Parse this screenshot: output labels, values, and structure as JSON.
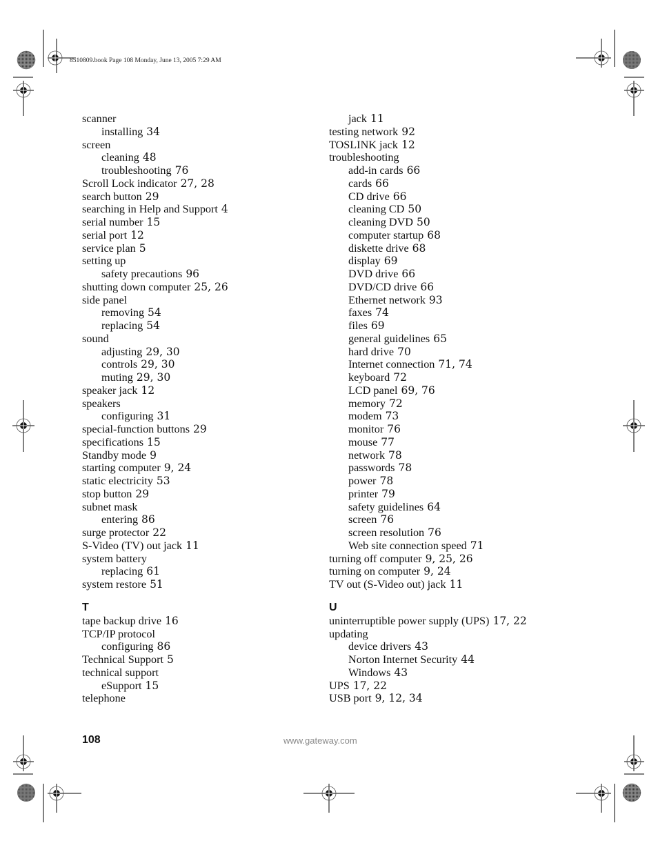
{
  "header": {
    "slug": "8510809.book  Page 108  Monday, June 13, 2005  7:29 AM"
  },
  "left_column": [
    {
      "term": "scanner",
      "pages": "",
      "level": 0
    },
    {
      "term": "installing",
      "pages": "34",
      "level": 1
    },
    {
      "term": "screen",
      "pages": "",
      "level": 0
    },
    {
      "term": "cleaning",
      "pages": "48",
      "level": 1
    },
    {
      "term": "troubleshooting",
      "pages": "76",
      "level": 1
    },
    {
      "term": "Scroll Lock indicator",
      "pages": "27, 28",
      "level": 0
    },
    {
      "term": "search button",
      "pages": "29",
      "level": 0
    },
    {
      "term": "searching in Help and Support",
      "pages": "4",
      "level": 0
    },
    {
      "term": "serial number",
      "pages": "15",
      "level": 0
    },
    {
      "term": "serial port",
      "pages": "12",
      "level": 0
    },
    {
      "term": "service plan",
      "pages": "5",
      "level": 0
    },
    {
      "term": "setting up",
      "pages": "",
      "level": 0
    },
    {
      "term": "safety precautions",
      "pages": "96",
      "level": 1
    },
    {
      "term": "shutting down computer",
      "pages": "25, 26",
      "level": 0
    },
    {
      "term": "side panel",
      "pages": "",
      "level": 0
    },
    {
      "term": "removing",
      "pages": "54",
      "level": 1
    },
    {
      "term": "replacing",
      "pages": "54",
      "level": 1
    },
    {
      "term": "sound",
      "pages": "",
      "level": 0
    },
    {
      "term": "adjusting",
      "pages": "29, 30",
      "level": 1
    },
    {
      "term": "controls",
      "pages": "29, 30",
      "level": 1
    },
    {
      "term": "muting",
      "pages": "29, 30",
      "level": 1
    },
    {
      "term": "speaker jack",
      "pages": "12",
      "level": 0
    },
    {
      "term": "speakers",
      "pages": "",
      "level": 0
    },
    {
      "term": "configuring",
      "pages": "31",
      "level": 1
    },
    {
      "term": "special-function buttons",
      "pages": "29",
      "level": 0
    },
    {
      "term": "specifications",
      "pages": "15",
      "level": 0
    },
    {
      "term": "Standby mode",
      "pages": "9",
      "level": 0
    },
    {
      "term": "starting computer",
      "pages": "9, 24",
      "level": 0
    },
    {
      "term": "static electricity",
      "pages": "53",
      "level": 0
    },
    {
      "term": "stop button",
      "pages": "29",
      "level": 0
    },
    {
      "term": "subnet mask",
      "pages": "",
      "level": 0
    },
    {
      "term": "entering",
      "pages": "86",
      "level": 1
    },
    {
      "term": "surge protector",
      "pages": "22",
      "level": 0
    },
    {
      "term": "S-Video (TV) out jack",
      "pages": "11",
      "level": 0
    },
    {
      "term": "system battery",
      "pages": "",
      "level": 0
    },
    {
      "term": "replacing",
      "pages": "61",
      "level": 1
    },
    {
      "term": "system restore",
      "pages": "51",
      "level": 0
    },
    {
      "letter": "T"
    },
    {
      "term": "tape backup drive",
      "pages": "16",
      "level": 0
    },
    {
      "term": "TCP/IP protocol",
      "pages": "",
      "level": 0
    },
    {
      "term": "configuring",
      "pages": "86",
      "level": 1
    },
    {
      "term": "Technical Support",
      "pages": "5",
      "level": 0
    },
    {
      "term": "technical support",
      "pages": "",
      "level": 0
    },
    {
      "term": "eSupport",
      "pages": "15",
      "level": 1
    },
    {
      "term": "telephone",
      "pages": "",
      "level": 0
    }
  ],
  "right_column": [
    {
      "term": "jack",
      "pages": "11",
      "level": 1
    },
    {
      "term": "testing network",
      "pages": "92",
      "level": 0
    },
    {
      "term": "TOSLINK jack",
      "pages": "12",
      "level": 0
    },
    {
      "term": "troubleshooting",
      "pages": "",
      "level": 0
    },
    {
      "term": "add-in cards",
      "pages": "66",
      "level": 1
    },
    {
      "term": "cards",
      "pages": "66",
      "level": 1
    },
    {
      "term": "CD drive",
      "pages": "66",
      "level": 1
    },
    {
      "term": "cleaning CD",
      "pages": "50",
      "level": 1
    },
    {
      "term": "cleaning DVD",
      "pages": "50",
      "level": 1
    },
    {
      "term": "computer startup",
      "pages": "68",
      "level": 1
    },
    {
      "term": "diskette drive",
      "pages": "68",
      "level": 1
    },
    {
      "term": "display",
      "pages": "69",
      "level": 1
    },
    {
      "term": "DVD drive",
      "pages": "66",
      "level": 1
    },
    {
      "term": "DVD/CD drive",
      "pages": "66",
      "level": 1
    },
    {
      "term": "Ethernet network",
      "pages": "93",
      "level": 1
    },
    {
      "term": "faxes",
      "pages": "74",
      "level": 1
    },
    {
      "term": "files",
      "pages": "69",
      "level": 1
    },
    {
      "term": "general guidelines",
      "pages": "65",
      "level": 1
    },
    {
      "term": "hard drive",
      "pages": "70",
      "level": 1
    },
    {
      "term": "Internet connection",
      "pages": "71, 74",
      "level": 1
    },
    {
      "term": "keyboard",
      "pages": "72",
      "level": 1
    },
    {
      "term": "LCD panel",
      "pages": "69, 76",
      "level": 1
    },
    {
      "term": "memory",
      "pages": "72",
      "level": 1
    },
    {
      "term": "modem",
      "pages": "73",
      "level": 1
    },
    {
      "term": "monitor",
      "pages": "76",
      "level": 1
    },
    {
      "term": "mouse",
      "pages": "77",
      "level": 1
    },
    {
      "term": "network",
      "pages": "78",
      "level": 1
    },
    {
      "term": "passwords",
      "pages": "78",
      "level": 1
    },
    {
      "term": "power",
      "pages": "78",
      "level": 1
    },
    {
      "term": "printer",
      "pages": "79",
      "level": 1
    },
    {
      "term": "safety guidelines",
      "pages": "64",
      "level": 1
    },
    {
      "term": "screen",
      "pages": "76",
      "level": 1
    },
    {
      "term": "screen resolution",
      "pages": "76",
      "level": 1
    },
    {
      "term": "Web site connection speed",
      "pages": "71",
      "level": 1
    },
    {
      "term": "turning off computer",
      "pages": "9, 25, 26",
      "level": 0
    },
    {
      "term": "turning on computer",
      "pages": "9, 24",
      "level": 0
    },
    {
      "term": "TV out (S-Video out) jack",
      "pages": "11",
      "level": 0
    },
    {
      "letter": "U"
    },
    {
      "term": "uninterruptible power supply (UPS)",
      "pages": "17, 22",
      "level": 0
    },
    {
      "term": "updating",
      "pages": "",
      "level": 0
    },
    {
      "term": "device drivers",
      "pages": "43",
      "level": 1
    },
    {
      "term": "Norton Internet Security",
      "pages": "44",
      "level": 1
    },
    {
      "term": "Windows",
      "pages": "43",
      "level": 1
    },
    {
      "term": "UPS",
      "pages": "17, 22",
      "level": 0
    },
    {
      "term": "USB port",
      "pages": "9, 12, 34",
      "level": 0
    }
  ],
  "footer": {
    "page_number": "108",
    "url": "www.gateway.com",
    "url_color": "#8a8a8a"
  }
}
